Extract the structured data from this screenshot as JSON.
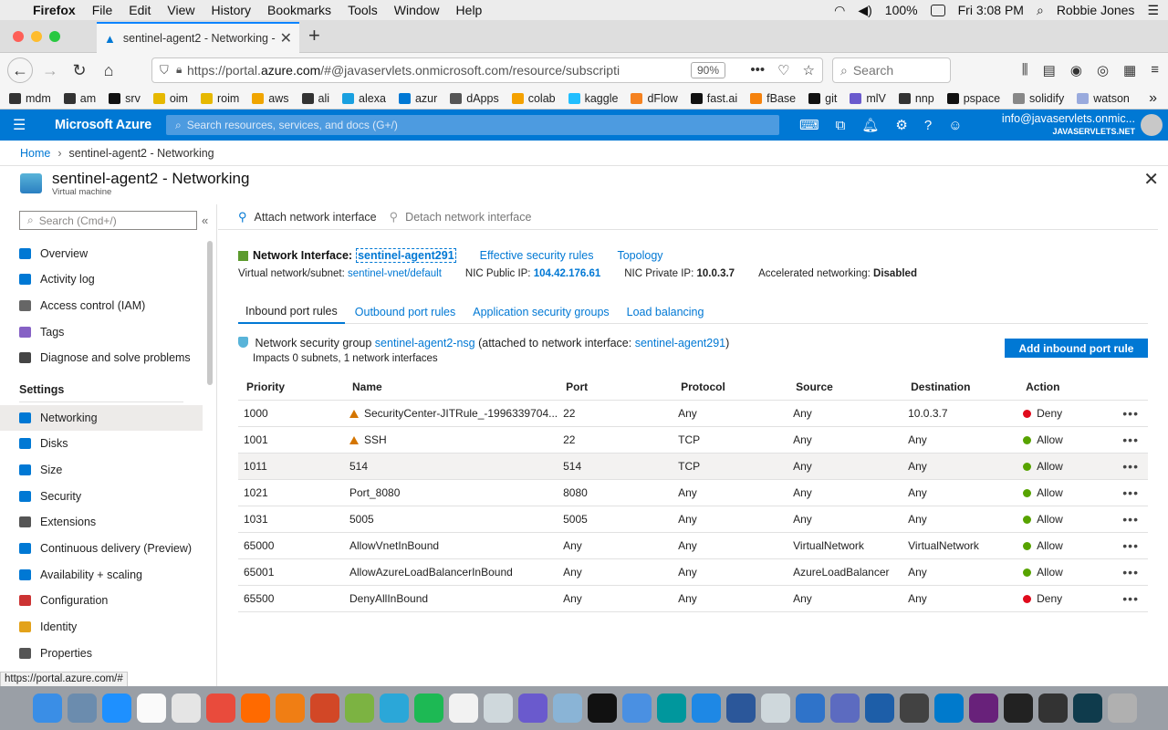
{
  "menubar": {
    "app": "Firefox",
    "items": [
      "File",
      "Edit",
      "View",
      "History",
      "Bookmarks",
      "Tools",
      "Window",
      "Help"
    ],
    "battery": "100%",
    "clock": "Fri 3:08 PM",
    "user": "Robbie Jones"
  },
  "browser": {
    "tab_title": "sentinel-agent2 - Networking -",
    "url_pre": "https://portal.",
    "url_domain": "azure.com",
    "url_post": "/#@javaservlets.onmicrosoft.com/resource/subscripti",
    "zoom": "90%",
    "search_placeholder": "Search",
    "bookmarks": [
      "mdm",
      "am",
      "srv",
      "oim",
      "roim",
      "aws",
      "ali",
      "alexa",
      "azur",
      "dApps",
      "colab",
      "kaggle",
      "dFlow",
      "fast.ai",
      "fBase",
      "git",
      "mlV",
      "nnp",
      "pspace",
      "solidify",
      "watson"
    ]
  },
  "azure": {
    "brand": "Microsoft Azure",
    "search_placeholder": "Search resources, services, and docs (G+/)",
    "user_email": "info@javaservlets.onmic...",
    "user_org": "JAVASERVLETS.NET"
  },
  "breadcrumb": {
    "home": "Home",
    "current": "sentinel-agent2 - Networking"
  },
  "page": {
    "title": "sentinel-agent2 - Networking",
    "subtitle": "Virtual machine"
  },
  "sidebar": {
    "search_placeholder": "Search (Cmd+/)",
    "items": [
      "Overview",
      "Activity log",
      "Access control (IAM)",
      "Tags",
      "Diagnose and solve problems"
    ],
    "settings_header": "Settings",
    "settings_items": [
      "Networking",
      "Disks",
      "Size",
      "Security",
      "Extensions",
      "Continuous delivery (Preview)",
      "Availability + scaling",
      "Configuration",
      "Identity",
      "Properties"
    ]
  },
  "commands": {
    "attach": "Attach network interface",
    "detach": "Detach network interface"
  },
  "nic": {
    "label": "Network Interface:",
    "name": "sentinel-agent291",
    "effective_rules": "Effective security rules",
    "topology": "Topology",
    "vnet_label": "Virtual network/subnet:",
    "vnet_value": "sentinel-vnet/default",
    "public_ip_label": "NIC Public IP:",
    "public_ip": "104.42.176.61",
    "private_ip_label": "NIC Private IP:",
    "private_ip": "10.0.3.7",
    "accel_label": "Accelerated networking:",
    "accel_value": "Disabled"
  },
  "tabs": [
    "Inbound port rules",
    "Outbound port rules",
    "Application security groups",
    "Load balancing"
  ],
  "nsg": {
    "prefix": "Network security group",
    "name": "sentinel-agent2-nsg",
    "middle": "(attached to network interface:",
    "nic": "sentinel-agent291",
    "suffix": ")",
    "impacts": "Impacts 0 subnets, 1 network interfaces",
    "add_button": "Add inbound port rule"
  },
  "table": {
    "headers": [
      "Priority",
      "Name",
      "Port",
      "Protocol",
      "Source",
      "Destination",
      "Action"
    ],
    "rows": [
      {
        "priority": "1000",
        "name": "SecurityCenter-JITRule_-1996339704...",
        "port": "22",
        "protocol": "Any",
        "source": "Any",
        "destination": "10.0.3.7",
        "action": "Deny"
      },
      {
        "priority": "1001",
        "name": "SSH",
        "port": "22",
        "protocol": "TCP",
        "source": "Any",
        "destination": "Any",
        "action": "Allow"
      },
      {
        "priority": "1011",
        "name": "514",
        "port": "514",
        "protocol": "TCP",
        "source": "Any",
        "destination": "Any",
        "action": "Allow"
      },
      {
        "priority": "1021",
        "name": "Port_8080",
        "port": "8080",
        "protocol": "Any",
        "source": "Any",
        "destination": "Any",
        "action": "Allow"
      },
      {
        "priority": "1031",
        "name": "5005",
        "port": "5005",
        "protocol": "Any",
        "source": "Any",
        "destination": "Any",
        "action": "Allow"
      },
      {
        "priority": "65000",
        "name": "AllowVnetInBound",
        "port": "Any",
        "protocol": "Any",
        "source": "VirtualNetwork",
        "destination": "VirtualNetwork",
        "action": "Allow"
      },
      {
        "priority": "65001",
        "name": "AllowAzureLoadBalancerInBound",
        "port": "Any",
        "protocol": "Any",
        "source": "AzureLoadBalancer",
        "destination": "Any",
        "action": "Allow"
      },
      {
        "priority": "65500",
        "name": "DenyAllInBound",
        "port": "Any",
        "protocol": "Any",
        "source": "Any",
        "destination": "Any",
        "action": "Deny"
      }
    ],
    "more": "•••"
  },
  "status_url": "https://portal.azure.com/#",
  "colors": {
    "accent": "#0078d4",
    "deny": "#e00b1c",
    "allow": "#57a300",
    "warn": "#d47500"
  }
}
